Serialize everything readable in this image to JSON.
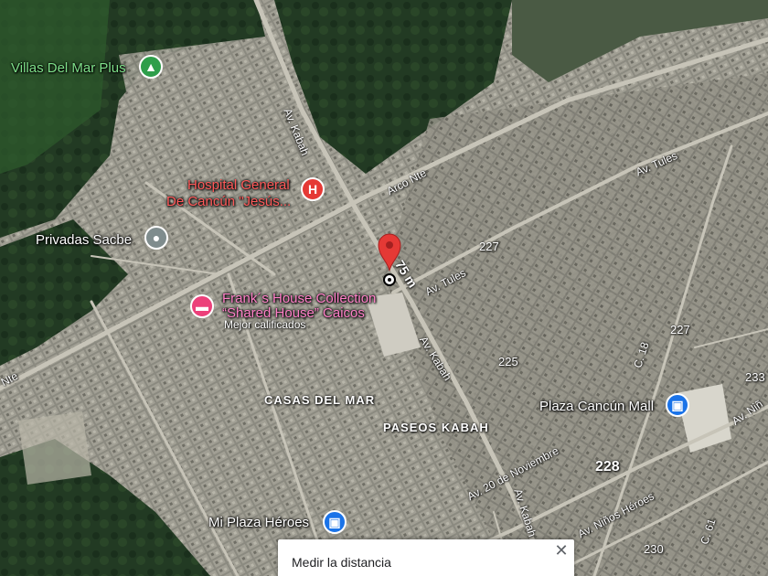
{
  "map": {
    "type": "satellite",
    "colors": {
      "poi_red": "#e53935",
      "poi_pink": "#ec407a",
      "poi_green": "#2e9e4a",
      "poi_blue": "#1a73e8",
      "poi_gray": "#7f8c8d"
    }
  },
  "places": [
    {
      "name": "Villas Del Mar Plus",
      "icon": "tree-icon"
    },
    {
      "name": "Hospital General",
      "line2": "De Cancún \"Jesús...",
      "icon": "hospital-icon"
    },
    {
      "name": "Privadas Sacbe",
      "icon": "place-icon"
    },
    {
      "name": "Frank´s House Collection",
      "line2": "“Shared House” Caicos",
      "sub": "Mejor calificados",
      "icon": "hotel-icon"
    },
    {
      "name": "Plaza Cancún Mall",
      "icon": "shopping-bag-icon"
    },
    {
      "name": "Mi Plaza Héroes",
      "icon": "shopping-bag-icon"
    }
  ],
  "areas": [
    "CASAS DEL MAR",
    "PASEOS KABAH"
  ],
  "streets": [
    "Av. Kabah",
    "Arco Nte",
    "Av. Tules",
    "Av. Tules",
    "Av. Kabah",
    "Av. 20 de Noviembre",
    "Av. Kabah",
    "Av. Niños Héroes",
    "Av. Niñ",
    "C. 18",
    "C. 61",
    "Nte"
  ],
  "routes": [
    "227",
    "227",
    "225",
    "228",
    "230",
    "233"
  ],
  "measure": {
    "distance": "75 m",
    "panel_title": "Medir la distancia",
    "close_icon": "close-icon"
  }
}
